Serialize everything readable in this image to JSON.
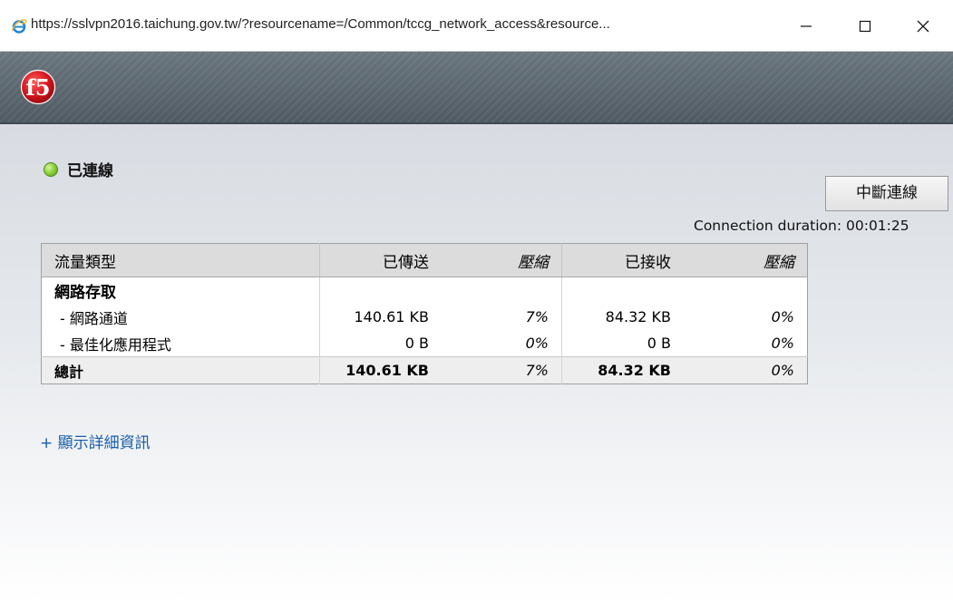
{
  "window": {
    "title": "https://sslvpn2016.taichung.gov.tw/?resourcename=/Common/tccg_network_access&resource...",
    "controls": [
      "minimize",
      "maximize",
      "close"
    ]
  },
  "icons": {
    "browser": "internet-explorer-icon",
    "logo": "f5-logo",
    "status": "green-status-icon"
  },
  "logo_text": "f5",
  "status": {
    "text": "已連線",
    "color": "#7ac23a"
  },
  "disconnect_label": "中斷連線",
  "duration": "Connection duration: 00:01:25",
  "table": {
    "headers": [
      "流量類型",
      "已傳送",
      "壓縮",
      "已接收",
      "壓縮"
    ],
    "group": "網路存取",
    "rows": [
      {
        "type": "- 網路通道",
        "sent": "140.61 KB",
        "sent_comp": "7%",
        "recv": "84.32 KB",
        "recv_comp": "0%"
      },
      {
        "type": "- 最佳化應用程式",
        "sent": "0 B",
        "sent_comp": "0%",
        "recv": "0 B",
        "recv_comp": "0%"
      }
    ],
    "total": {
      "type": "總計",
      "sent": "140.61 KB",
      "sent_comp": "7%",
      "recv": "84.32 KB",
      "recv_comp": "0%"
    }
  },
  "details_link": "+ 顯示詳細資訊",
  "colors": {
    "banner": "#5e6a72",
    "link": "#1a5ea8",
    "accent_red": "#c8161d"
  }
}
